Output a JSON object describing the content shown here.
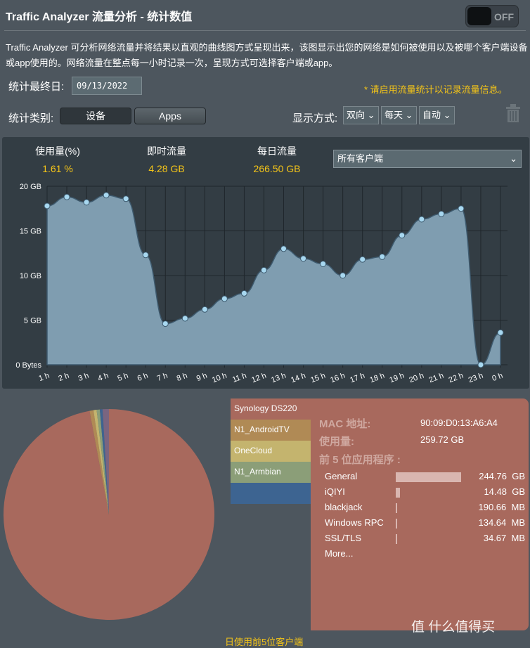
{
  "header": {
    "title": "Traffic Analyzer 流量分析 - 统计数值",
    "toggle": "OFF",
    "description": "Traffic Analyzer 可分析网络流量并将结果以直观的曲线图方式呈现出来，该图显示出您的网络是如何被使用以及被哪个客户端设备或app使用的。网络流量在整点每一小时记录一次，呈现方式可选择客户端或app。"
  },
  "controls": {
    "end_date_label": "统计最终日:",
    "end_date": "09/13/2022",
    "warning": "* 请启用流量统计以记录流量信息。",
    "category_label": "统计类别:",
    "cat_device": "设备",
    "cat_apps": "Apps",
    "display_label": "显示方式:",
    "direction": "双向",
    "period": "每天",
    "scale": "自动",
    "trash_icon": "trash-icon"
  },
  "stats": {
    "usage_label": "使用量(%)",
    "usage": "1.61 %",
    "realtime_label": "即时流量",
    "realtime": "4.28 GB",
    "daily_label": "每日流量",
    "daily": "266.50 GB",
    "client_select": "所有客户端"
  },
  "chart_data": {
    "type": "area",
    "x": [
      "1 h",
      "2 h",
      "3 h",
      "4 h",
      "5 h",
      "6 h",
      "7 h",
      "8 h",
      "9 h",
      "10 h",
      "11 h",
      "12 h",
      "13 h",
      "14 h",
      "15 h",
      "16 h",
      "17 h",
      "18 h",
      "19 h",
      "20 h",
      "21 h",
      "22 h",
      "23 h",
      "0 h"
    ],
    "values": [
      17.8,
      18.8,
      18.2,
      19.0,
      18.6,
      12.3,
      4.6,
      5.2,
      6.2,
      7.4,
      8.0,
      10.6,
      13.0,
      11.9,
      11.3,
      10.0,
      11.8,
      12.1,
      14.5,
      16.3,
      16.9,
      17.5,
      0,
      3.6
    ],
    "unit": "GB",
    "ylim": [
      0,
      20
    ],
    "yticks": [
      "0 Bytes",
      "5 GB",
      "10 GB",
      "15 GB",
      "20 GB"
    ],
    "grid": true,
    "fill": "#7f9db0",
    "point": "#a8d8f0"
  },
  "pie": {
    "caption": "日使用前5位客户端",
    "slices": [
      {
        "label": "Synology DS220",
        "value": 259.72,
        "color": "#a8695d"
      },
      {
        "label": "N1_AndroidTV",
        "value": 1.6,
        "color": "#b08a55"
      },
      {
        "label": "OneCloud",
        "value": 1.3,
        "color": "#c4b46e"
      },
      {
        "label": "N1_Armbian",
        "value": 1.3,
        "color": "#8b9e78"
      },
      {
        "label": "",
        "value": 1.1,
        "color": "#3d6491"
      },
      {
        "label": "",
        "value": 2.6,
        "color": "#7a6580"
      }
    ]
  },
  "detail": {
    "mac_label": "MAC 地址:",
    "mac": "90:09:D0:13:A6:A4",
    "usage_label": "使用量:",
    "usage": "259.72 GB",
    "top_label": "前 5 位应用程序 :",
    "apps": [
      {
        "name": "General",
        "size": "244.76",
        "unit": "GB",
        "frac": 1
      },
      {
        "name": "iQIYI",
        "size": "14.48",
        "unit": "GB",
        "frac": 0.06
      },
      {
        "name": "blackjack",
        "size": "190.66",
        "unit": "MB",
        "frac": 0.003
      },
      {
        "name": "Windows RPC",
        "size": "134.64",
        "unit": "MB",
        "frac": 0.003
      },
      {
        "name": "SSL/TLS",
        "size": "34.67",
        "unit": "MB",
        "frac": 0.003
      }
    ],
    "more": "More..."
  },
  "watermark": "值 什么值得买"
}
